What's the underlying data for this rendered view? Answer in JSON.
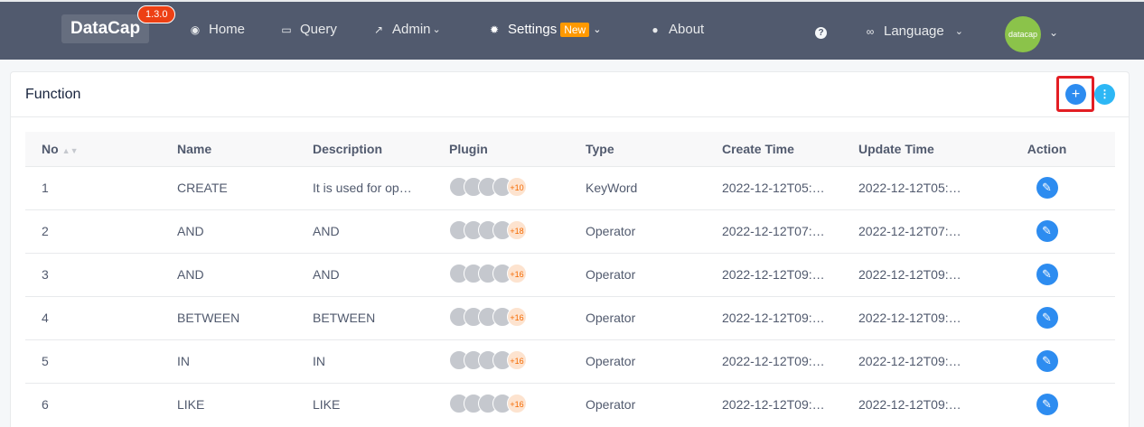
{
  "header": {
    "logo": "DataCap",
    "version": "1.3.0",
    "nav": [
      {
        "label": "Home",
        "icon": "home-icon"
      },
      {
        "label": "Query",
        "icon": "window-icon"
      },
      {
        "label": "Admin",
        "icon": "hammer-icon"
      },
      {
        "label": "Settings",
        "icon": "gear-icon",
        "badge": "New"
      },
      {
        "label": "About",
        "icon": "info-icon"
      }
    ],
    "language": "Language",
    "avatar_text": "datacap"
  },
  "card": {
    "title": "Function"
  },
  "table": {
    "columns": [
      "No",
      "Name",
      "Description",
      "Plugin",
      "Type",
      "Create Time",
      "Update Time",
      "Action"
    ],
    "rows": [
      {
        "no": "1",
        "name": "CREATE",
        "description": "It is used for op…",
        "plugin_more": "+10",
        "type": "KeyWord",
        "create_time": "2022-12-12T05:…",
        "update_time": "2022-12-12T05:…"
      },
      {
        "no": "2",
        "name": "AND",
        "description": "AND",
        "plugin_more": "+18",
        "type": "Operator",
        "create_time": "2022-12-12T07:…",
        "update_time": "2022-12-12T07:…"
      },
      {
        "no": "3",
        "name": "AND",
        "description": "AND",
        "plugin_more": "+16",
        "type": "Operator",
        "create_time": "2022-12-12T09:…",
        "update_time": "2022-12-12T09:…"
      },
      {
        "no": "4",
        "name": "BETWEEN",
        "description": "BETWEEN",
        "plugin_more": "+16",
        "type": "Operator",
        "create_time": "2022-12-12T09:…",
        "update_time": "2022-12-12T09:…"
      },
      {
        "no": "5",
        "name": "IN",
        "description": "IN",
        "plugin_more": "+16",
        "type": "Operator",
        "create_time": "2022-12-12T09:…",
        "update_time": "2022-12-12T09:…"
      },
      {
        "no": "6",
        "name": "LIKE",
        "description": "LIKE",
        "plugin_more": "+16",
        "type": "Operator",
        "create_time": "2022-12-12T09:…",
        "update_time": "2022-12-12T09:…"
      }
    ]
  },
  "colors": {
    "header_bg": "#515a6e",
    "primary": "#2d8cf0",
    "info": "#2db7f5",
    "version_badge": "#ed4014",
    "new_badge": "#ff9900",
    "highlight": "#e31e24",
    "avatar": "#8bc34a"
  }
}
